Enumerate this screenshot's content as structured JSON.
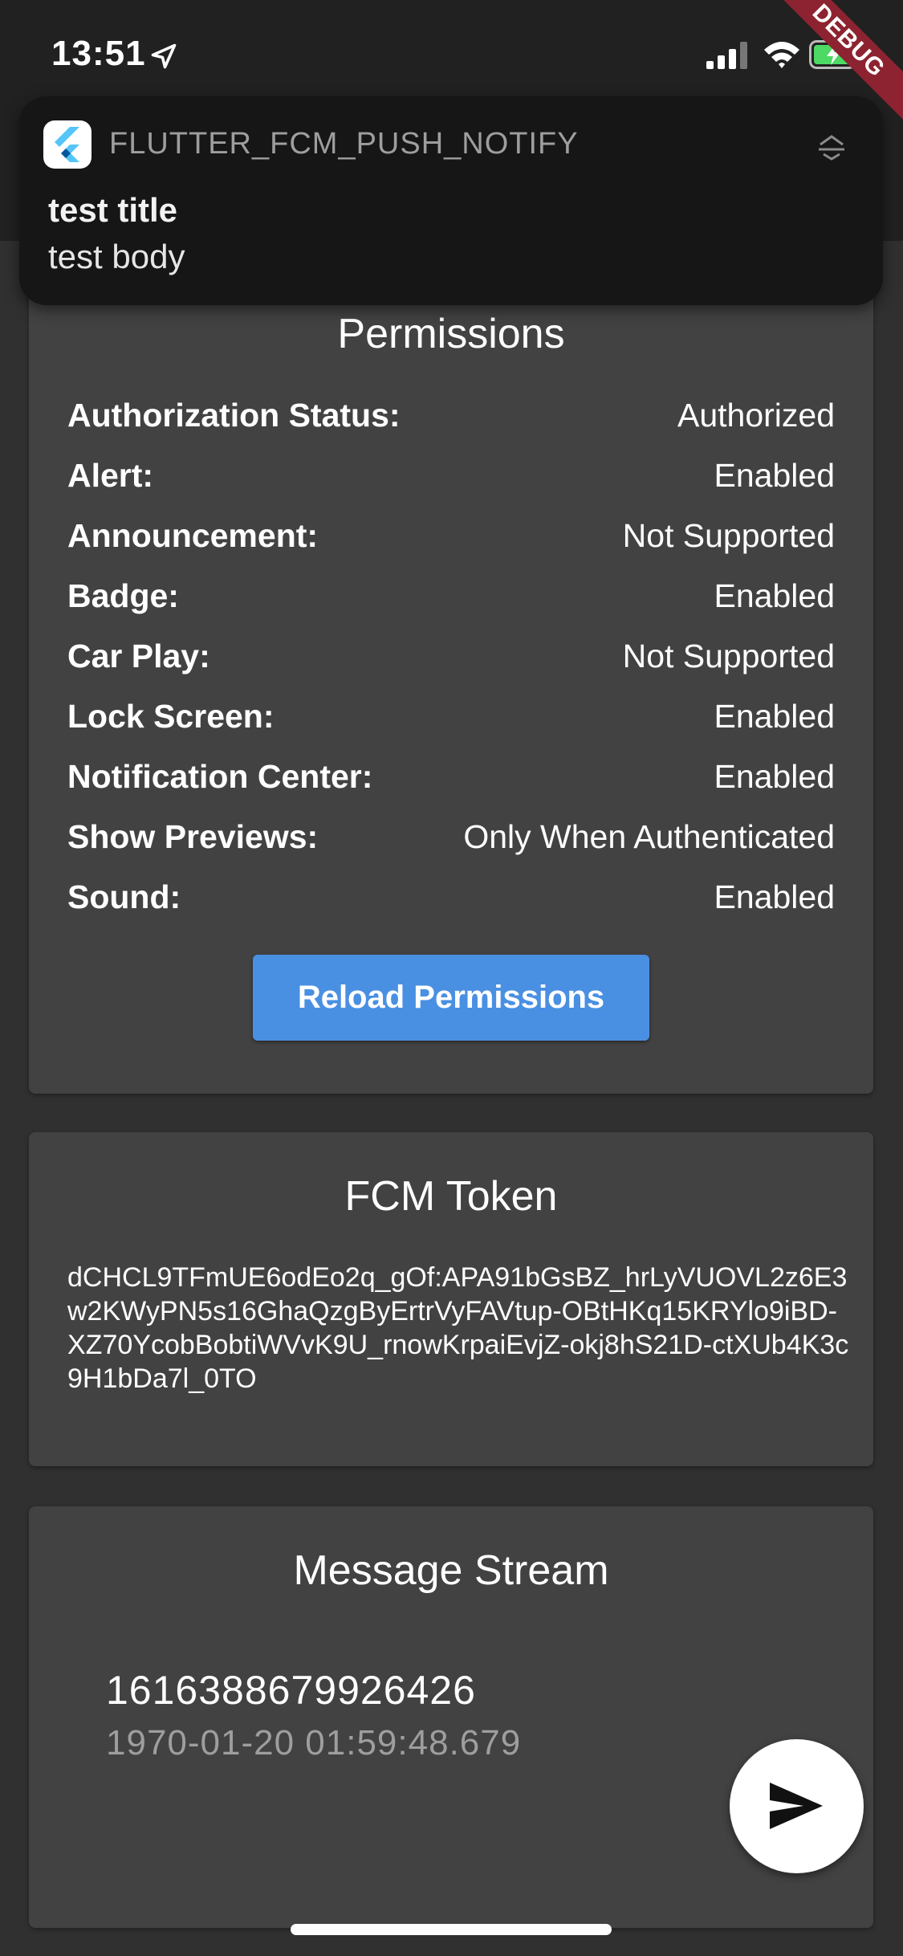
{
  "status_bar": {
    "time": "13:51",
    "icons": [
      "location-arrow-icon",
      "cellular-signal-icon",
      "wifi-icon",
      "battery-charging-icon"
    ]
  },
  "debug_banner": {
    "label": "DEBUG"
  },
  "notification": {
    "app_icon": "flutter-logo-icon",
    "app_name": "FLUTTER_FCM_PUSH_NOTIFY",
    "title": "test title",
    "body": "test body"
  },
  "permissions": {
    "title": "Permissions",
    "rows": [
      {
        "label": "Authorization Status:",
        "value": "Authorized"
      },
      {
        "label": "Alert:",
        "value": "Enabled"
      },
      {
        "label": "Announcement:",
        "value": "Not Supported"
      },
      {
        "label": "Badge:",
        "value": "Enabled"
      },
      {
        "label": "Car Play:",
        "value": "Not Supported"
      },
      {
        "label": "Lock Screen:",
        "value": "Enabled"
      },
      {
        "label": "Notification Center:",
        "value": "Enabled"
      },
      {
        "label": "Show Previews:",
        "value": "Only When Authenticated"
      },
      {
        "label": "Sound:",
        "value": "Enabled"
      }
    ],
    "reload_label": "Reload Permissions"
  },
  "fcm_token": {
    "title": "FCM Token",
    "value": "dCHCL9TFmUE6odEo2q_gOf:APA91bGsBZ_hrLyVUOVL2z6E3w2KWyPN5s16GhaQzgByErtrVyFAVtup-OBtHKq15KRYlo9iBD-XZ70YcobBobtiWVvK9U_rnowKrpaiEvjZ-okj8hS21D-ctXUb4K3c9H1bDa7l_0TO"
  },
  "message_stream": {
    "title": "Message Stream",
    "message_id": "1616388679926426",
    "timestamp": "1970-01-20 01:59:48.679"
  },
  "fab": {
    "icon": "send-icon"
  },
  "colors": {
    "background": "#303030",
    "card": "#424242",
    "accent_button": "#4a90e2",
    "debug_banner": "#8d2330",
    "secondary_text": "#9e9e9e"
  }
}
